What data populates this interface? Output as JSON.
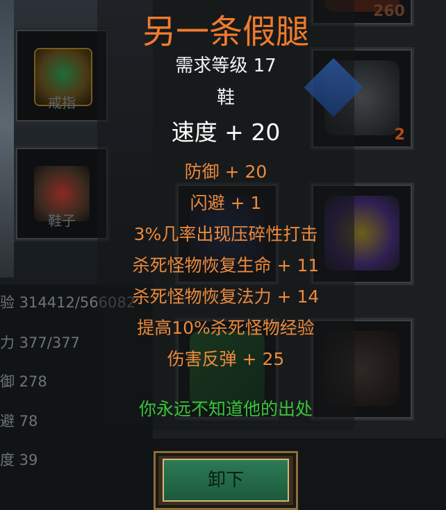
{
  "left_slots": [
    {
      "icon": "ring-icon",
      "label": "戒指"
    },
    {
      "icon": "boots-icon",
      "label": "鞋子"
    }
  ],
  "stats": [
    {
      "text": "验 314412/566082"
    },
    {
      "text": "力 377/377"
    },
    {
      "text": "御 278"
    },
    {
      "text": "避 78"
    },
    {
      "text": "度 39"
    }
  ],
  "equipment": {
    "slot_helmet_top": {
      "icon": "armor-icon",
      "badge": "260"
    },
    "slot_gem": {
      "icon": "gem-icon",
      "badge": "2"
    },
    "slot_dragon": {
      "icon": "dragon-armor-icon",
      "badge": ""
    },
    "slot_belt": {
      "icon": "belt-icon",
      "badge": ""
    },
    "slot_green": {
      "icon": "green-crystal-icon",
      "badge": ""
    }
  },
  "tooltip": {
    "name": "另一条假腿",
    "level_req": "需求等级 17",
    "item_type": "鞋",
    "main_stat": "速度 + 20",
    "attributes": [
      "防御 + 20",
      "闪避 + 1",
      "3%几率出现压碎性打击",
      "杀死怪物恢复生命 + 11",
      "杀死怪物恢复法力 + 14",
      "提高10%杀死怪物经验",
      "伤害反弹 + 25"
    ],
    "flavor": "你永远不知道他的出处"
  },
  "buttons": {
    "unequip_label": "卸下"
  },
  "colors": {
    "item_name": "#f07b2d",
    "attribute": "#ec8a3c",
    "flavor": "#39c43a",
    "main_text": "#ffffff"
  }
}
